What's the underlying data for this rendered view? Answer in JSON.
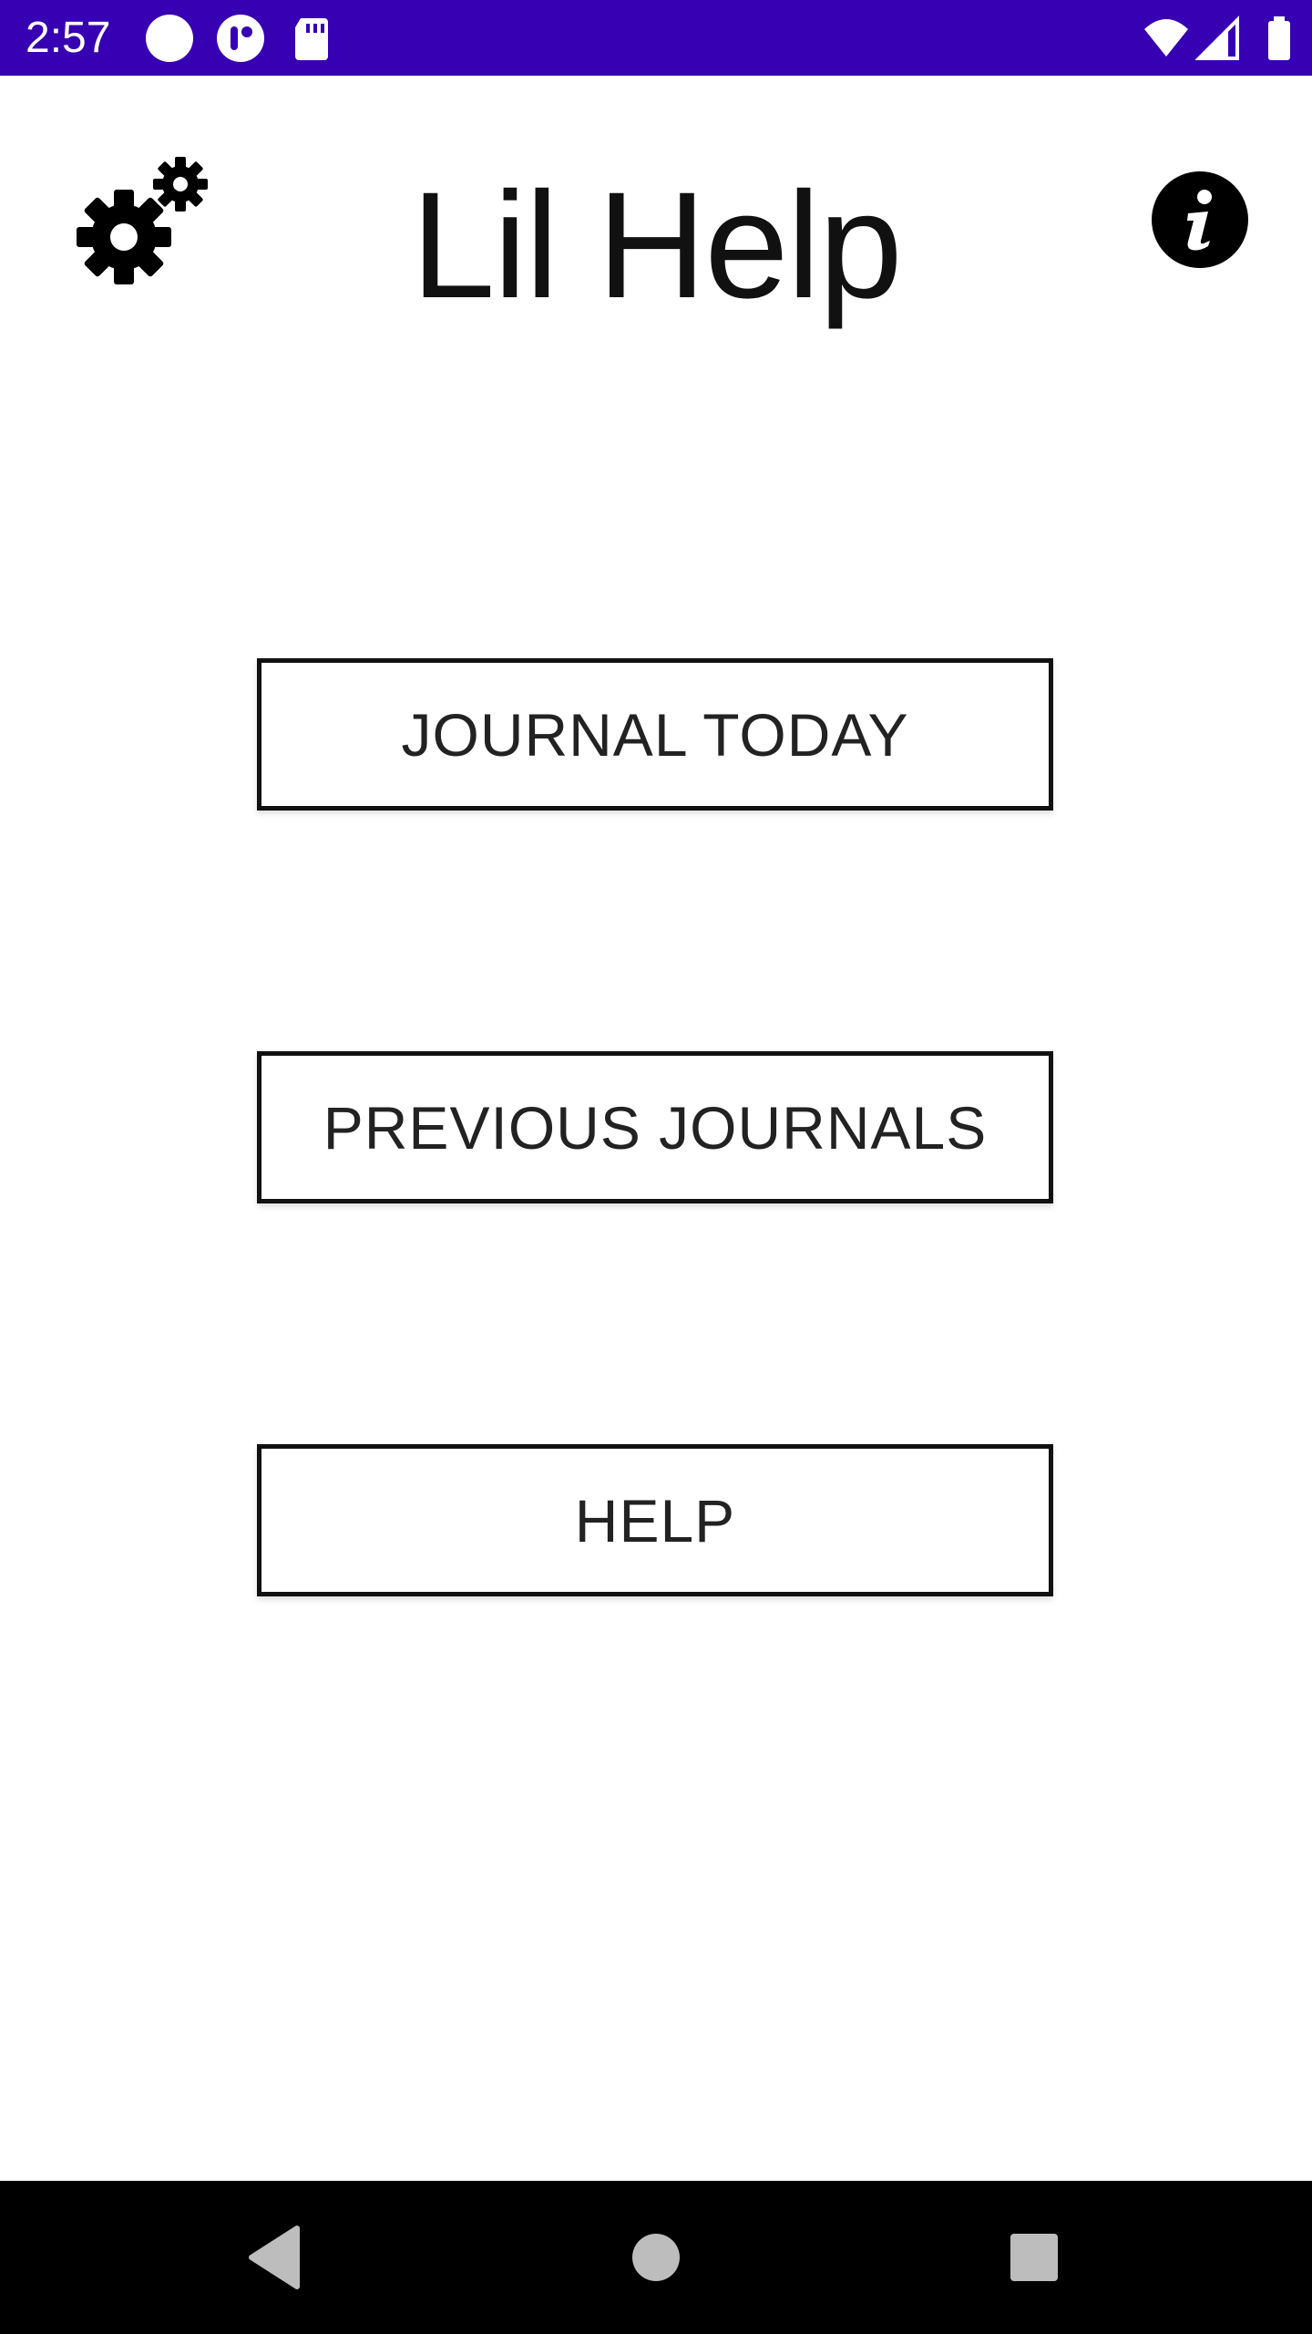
{
  "status_bar": {
    "time": "2:57",
    "background_color": "#3700b3",
    "icons": [
      "circle-notification-icon",
      "app-notification-icon",
      "sd-card-icon",
      "wifi-icon",
      "cellular-signal-icon",
      "battery-icon"
    ]
  },
  "header": {
    "title": "Lil Help",
    "settings_icon": "gear-icon",
    "info_icon": "info-icon"
  },
  "main": {
    "buttons": [
      {
        "label": "JOURNAL TODAY"
      },
      {
        "label": "PREVIOUS JOURNALS"
      },
      {
        "label": "HELP"
      }
    ]
  },
  "nav_bar": {
    "icons": [
      "back-icon",
      "home-icon",
      "recents-icon"
    ],
    "icon_color": "#bdbdbd"
  }
}
